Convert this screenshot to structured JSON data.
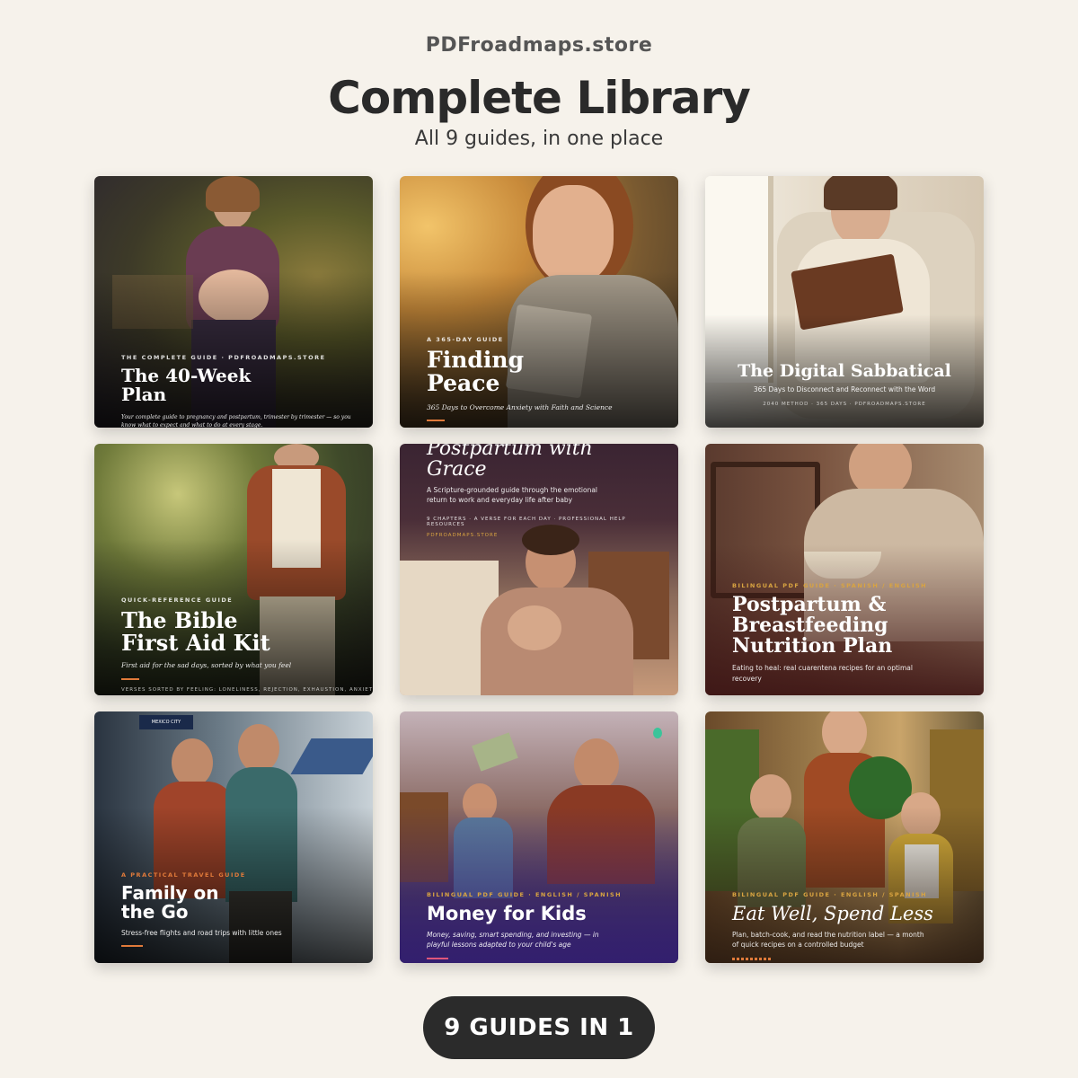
{
  "header": {
    "brand": "PDFroadmaps.store",
    "title": "Complete Library",
    "subtitle": "All 9 guides, in one place"
  },
  "guides": [
    {
      "kicker": "THE COMPLETE GUIDE · PDFROADMAPS.STORE",
      "title": "The 40-Week Plan",
      "description": "Your complete guide to pregnancy and postpartum, trimester by trimester — so you know what to expect and what to do at every stage."
    },
    {
      "kicker": "A 365-DAY GUIDE",
      "title": "Finding Peace",
      "description": "365 Days to Overcome Anxiety with Faith and Science"
    },
    {
      "title": "The Digital Sabbatical",
      "description": "365 Days to Disconnect and Reconnect with the Word",
      "footer": "2040 METHOD · 365 DAYS · PDFROADMAPS.STORE"
    },
    {
      "kicker": "QUICK-REFERENCE GUIDE",
      "title": "The Bible First Aid Kit",
      "description": "First aid for the sad days, sorted by what you feel",
      "footer": "VERSES SORTED BY FEELING: LONELINESS, REJECTION, EXHAUSTION, ANXIETY,"
    },
    {
      "title": "Postpartum with Grace",
      "description": "A Scripture-grounded guide through the emotional return to work and everyday life after baby",
      "meta": "9 CHAPTERS · A VERSE FOR EACH DAY · PROFESSIONAL HELP RESOURCES",
      "footer": "PDFROADMAPS.STORE"
    },
    {
      "kicker": "BILINGUAL PDF GUIDE · SPANISH / ENGLISH",
      "title": "Postpartum & Breastfeeding Nutrition Plan",
      "description": "Eating to heal: real cuarentena recipes for an optimal recovery"
    },
    {
      "kicker": "A PRACTICAL TRAVEL GUIDE",
      "title": "Family on the Go",
      "description": "Stress-free flights and road trips with little ones",
      "sign": "MEXICO CITY"
    },
    {
      "kicker": "BILINGUAL PDF GUIDE · ENGLISH / SPANISH",
      "title": "Money for Kids",
      "description": "Money, saving, smart spending, and investing — in playful lessons adapted to your child's age"
    },
    {
      "kicker": "BILINGUAL PDF GUIDE · ENGLISH / SPANISH",
      "title": "Eat Well, Spend Less",
      "description": "Plan, batch-cook, and read the nutrition label — a month of quick recipes on a controlled budget"
    }
  ],
  "cta": {
    "label": "9 GUIDES IN 1"
  },
  "colors": {
    "background": "#f6f2eb",
    "cta_background": "#2b2b2b",
    "accent_orange": "#e07a3a",
    "accent_pink": "#e0567a",
    "accent_gold": "#d9a441"
  }
}
